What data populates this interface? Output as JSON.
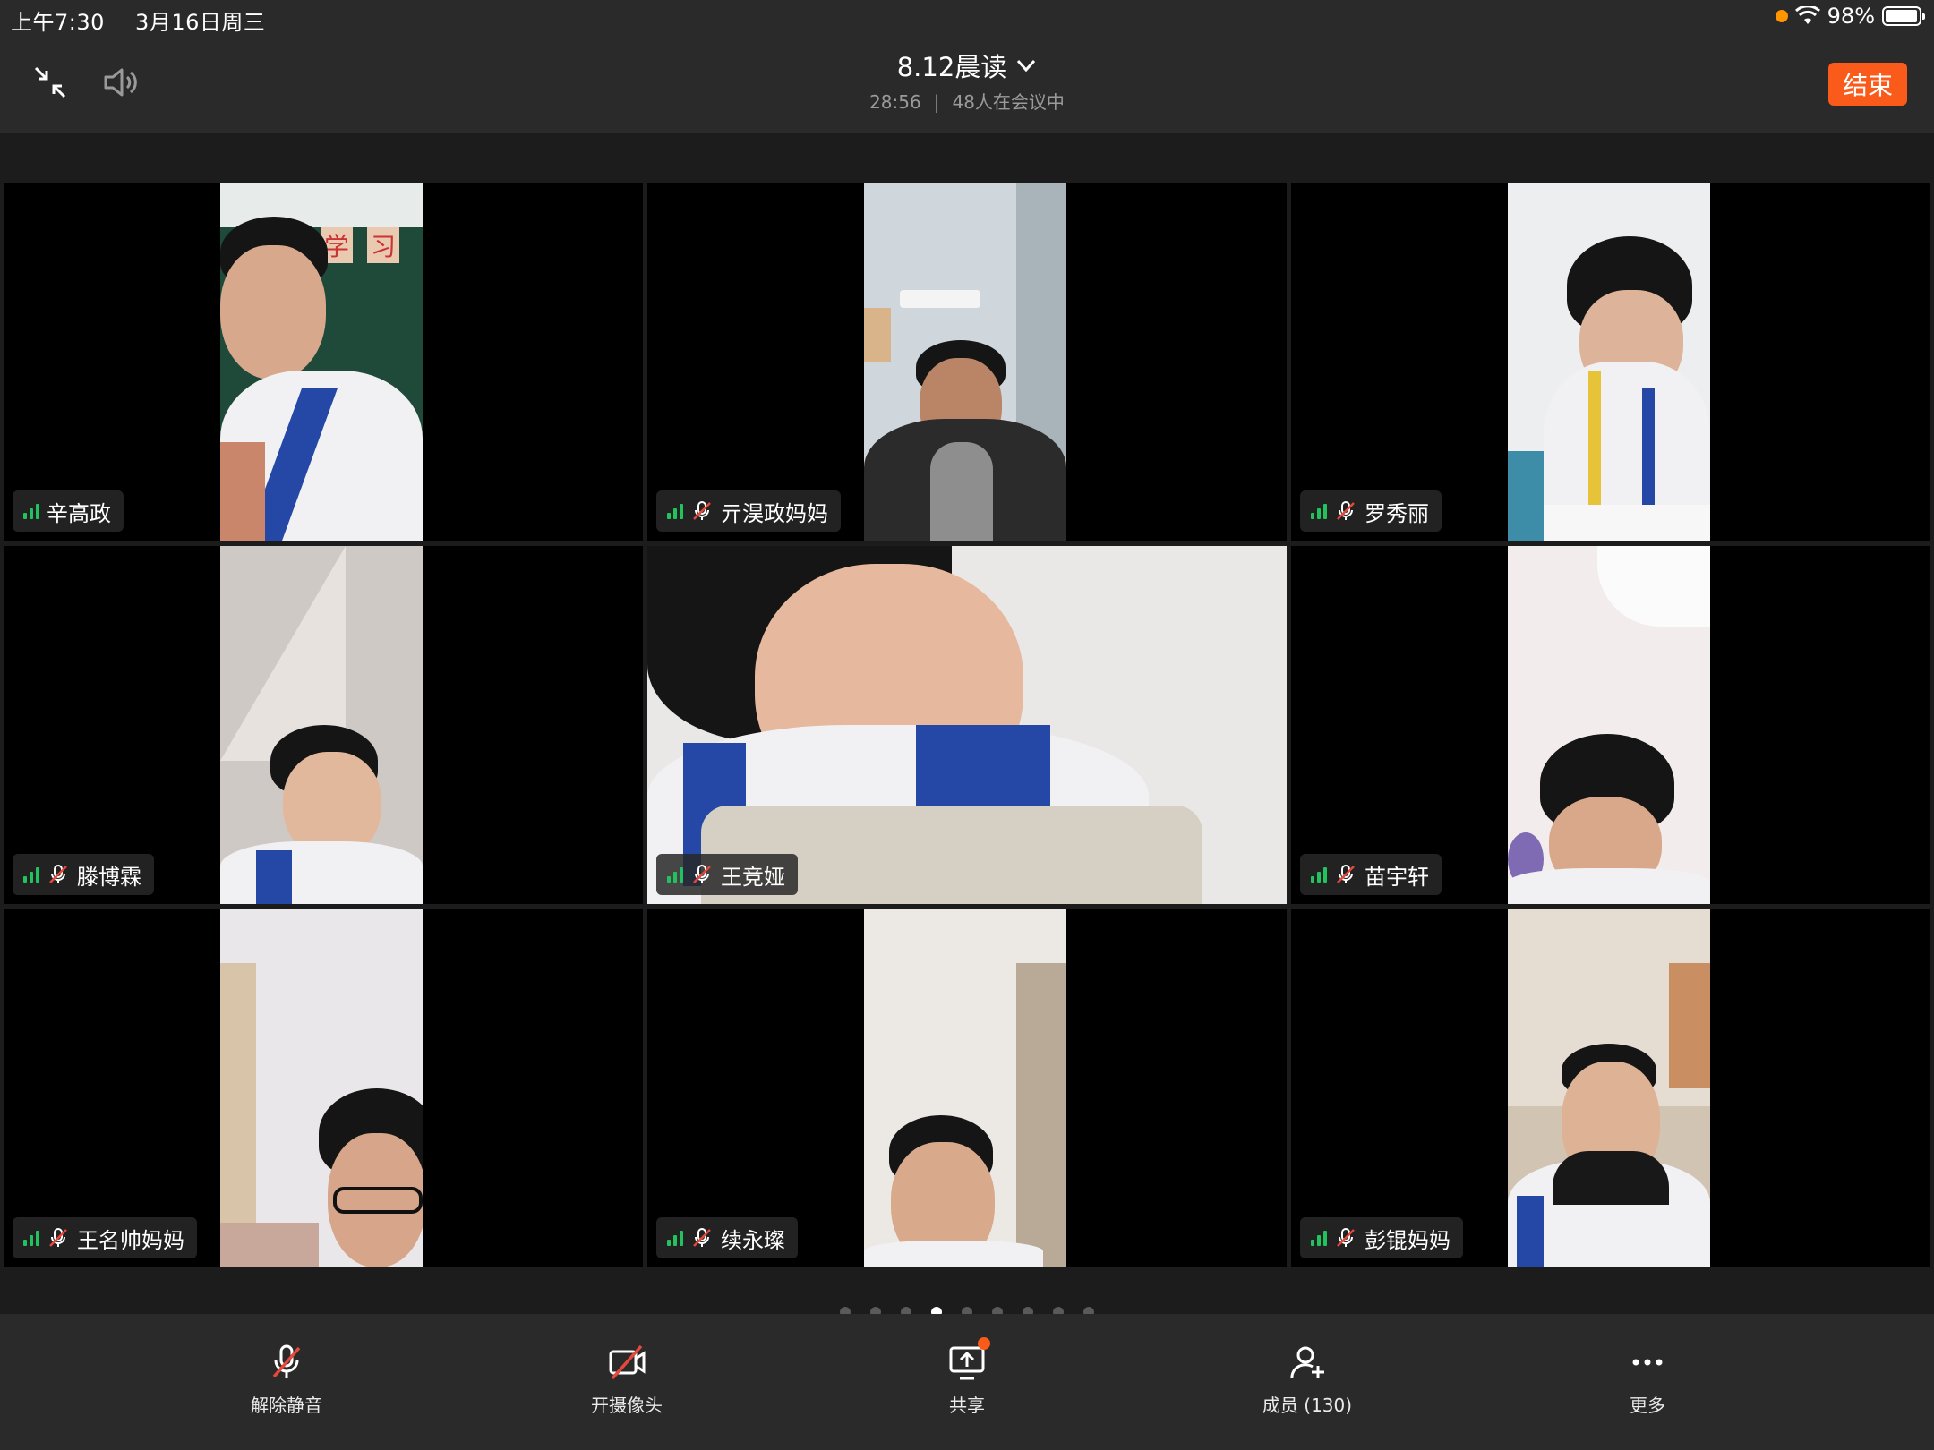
{
  "status_bar": {
    "time": "上午7:30",
    "date": "3月16日周三",
    "battery_text": "98%",
    "battery_level": 0.98
  },
  "header": {
    "meeting_title": "8.12晨读",
    "elapsed": "28:56",
    "separator": "|",
    "participants_in_meeting": "48人在会议中",
    "end_label": "结束"
  },
  "colors": {
    "accent": "#fa5a1a",
    "signal_green": "#22c35e",
    "muted_red": "#e5483c"
  },
  "participants": [
    {
      "name": "辛高政",
      "muted": false
    },
    {
      "name": "亓淏政妈妈",
      "muted": true
    },
    {
      "name": "罗秀丽",
      "muted": true
    },
    {
      "name": "滕博霖",
      "muted": true
    },
    {
      "name": "王竞娅",
      "muted": true,
      "active_speaker": true
    },
    {
      "name": "苗宇轩",
      "muted": true
    },
    {
      "name": "王名帅妈妈",
      "muted": true
    },
    {
      "name": "续永璨",
      "muted": true
    },
    {
      "name": "彭锟妈妈",
      "muted": true
    }
  ],
  "pagination": {
    "pages": 9,
    "current": 4
  },
  "toolbar": {
    "unmute": "解除静音",
    "camera": "开摄像头",
    "share": "共享",
    "members": "成员 (130)",
    "more": "更多"
  },
  "icons": [
    "minimize-icon",
    "speaker-icon",
    "chevron-down-icon",
    "signal-icon",
    "mic-off-icon",
    "camera-off-icon",
    "share-screen-icon",
    "add-member-icon",
    "more-icon"
  ]
}
